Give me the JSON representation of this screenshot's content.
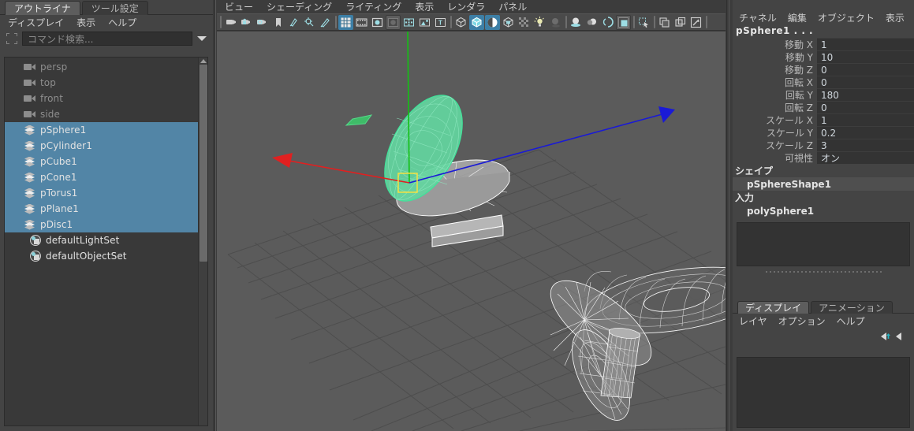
{
  "outliner_panel": {
    "tabs": [
      {
        "label": "アウトライナ",
        "active": true
      },
      {
        "label": "ツール設定",
        "active": false
      }
    ],
    "menu": [
      "ディスプレイ",
      "表示",
      "ヘルプ"
    ],
    "search": {
      "placeholder": "コマンド検索...",
      "value": ""
    },
    "items": [
      {
        "label": "persp",
        "icon": "camera-icon",
        "selected": false,
        "dim": true,
        "indent": 1
      },
      {
        "label": "top",
        "icon": "camera-icon",
        "selected": false,
        "dim": true,
        "indent": 1
      },
      {
        "label": "front",
        "icon": "camera-icon",
        "selected": false,
        "dim": true,
        "indent": 1
      },
      {
        "label": "side",
        "icon": "camera-icon",
        "selected": false,
        "dim": true,
        "indent": 1
      },
      {
        "label": "pSphere1",
        "icon": "mesh-icon",
        "selected": true,
        "dim": false,
        "indent": 1
      },
      {
        "label": "pCylinder1",
        "icon": "mesh-icon",
        "selected": true,
        "dim": false,
        "indent": 1
      },
      {
        "label": "pCube1",
        "icon": "mesh-icon",
        "selected": true,
        "dim": false,
        "indent": 1
      },
      {
        "label": "pCone1",
        "icon": "mesh-icon",
        "selected": true,
        "dim": false,
        "indent": 1
      },
      {
        "label": "pTorus1",
        "icon": "mesh-icon",
        "selected": true,
        "dim": false,
        "indent": 1
      },
      {
        "label": "pPlane1",
        "icon": "mesh-icon",
        "selected": true,
        "dim": false,
        "indent": 1
      },
      {
        "label": "pDisc1",
        "icon": "mesh-icon",
        "selected": true,
        "dim": false,
        "indent": 1
      },
      {
        "label": "defaultLightSet",
        "icon": "set-icon",
        "selected": false,
        "dim": false,
        "indent": 2
      },
      {
        "label": "defaultObjectSet",
        "icon": "set-icon",
        "selected": false,
        "dim": false,
        "indent": 2
      }
    ]
  },
  "viewport_panel": {
    "menu": [
      "ビュー",
      "シェーディング",
      "ライティング",
      "表示",
      "レンダラ",
      "パネル"
    ],
    "toolbar": [
      {
        "name": "separator",
        "type": "sep"
      },
      {
        "name": "camera-icon",
        "type": "btn",
        "state": "off"
      },
      {
        "name": "camera-lock-icon",
        "type": "btn",
        "state": "off"
      },
      {
        "name": "camera-settings-icon",
        "type": "btn",
        "state": "off"
      },
      {
        "name": "bookmark-icon",
        "type": "btn",
        "state": "off"
      },
      {
        "name": "image-plane-icon",
        "type": "btn",
        "state": "off"
      },
      {
        "name": "two-d-pan-zoom-icon",
        "type": "btn",
        "state": "off"
      },
      {
        "name": "grease-pencil-icon",
        "type": "btn",
        "state": "off"
      },
      {
        "name": "separator",
        "type": "sep"
      },
      {
        "name": "grid-icon",
        "type": "btn",
        "state": "on"
      },
      {
        "name": "film-gate-icon",
        "type": "btn",
        "state": "off"
      },
      {
        "name": "resolution-gate-icon",
        "type": "btn",
        "state": "off"
      },
      {
        "name": "gate-mask-icon",
        "type": "btn",
        "state": "on2"
      },
      {
        "name": "film-origin-icon",
        "type": "btn",
        "state": "off"
      },
      {
        "name": "field-chart-icon",
        "type": "btn",
        "state": "off"
      },
      {
        "name": "safe-title-icon",
        "type": "btn",
        "state": "off"
      },
      {
        "name": "separator",
        "type": "sep"
      },
      {
        "name": "wireframe-icon",
        "type": "btn",
        "state": "off"
      },
      {
        "name": "smooth-shade-icon",
        "type": "btn",
        "state": "on"
      },
      {
        "name": "shade-wireframe-icon",
        "type": "btn",
        "state": "on"
      },
      {
        "name": "texture-icon",
        "type": "btn",
        "state": "off"
      },
      {
        "name": "xray-icon",
        "type": "btn",
        "state": "off"
      },
      {
        "name": "lighting-icon",
        "type": "btn",
        "state": "off"
      },
      {
        "name": "shadows-icon",
        "type": "btn",
        "state": "off"
      },
      {
        "name": "separator",
        "type": "sep"
      },
      {
        "name": "ao-icon",
        "type": "btn",
        "state": "off"
      },
      {
        "name": "motion-blur-icon",
        "type": "btn",
        "state": "off"
      },
      {
        "name": "anti-alias-icon",
        "type": "btn",
        "state": "off"
      },
      {
        "name": "viewport-fx-icon",
        "type": "btn",
        "state": "on2"
      },
      {
        "name": "separator",
        "type": "sep"
      },
      {
        "name": "isolate-select-icon",
        "type": "btn",
        "state": "off"
      },
      {
        "name": "separator",
        "type": "sep"
      },
      {
        "name": "copy-view-icon",
        "type": "btn",
        "state": "off"
      },
      {
        "name": "paste-view-icon",
        "type": "btn",
        "state": "off"
      },
      {
        "name": "snapshot-icon",
        "type": "btn",
        "state": "off"
      },
      {
        "name": "separator",
        "type": "sep"
      }
    ],
    "scene": {
      "background_color": "#5b5b5b",
      "grid_color": "#4f4f4f",
      "selected_object": "pSphere1",
      "selected_highlight_color": "#5dd79a",
      "manipulator": "move-manipulator",
      "axis_colors": {
        "x": "#e02020",
        "y": "#13c113",
        "z": "#1a1ad6"
      },
      "objects": [
        "pPlane1",
        "pSphere1",
        "pDisc1",
        "pCube1",
        "pTorus1",
        "pCone1",
        "pCylinder1"
      ]
    }
  },
  "channel_box": {
    "menu": [
      "チャネル",
      "編集",
      "オブジェクト",
      "表示"
    ],
    "object_name": "pSphere1 . . .",
    "channels": [
      {
        "label": "移動 X",
        "value": "1"
      },
      {
        "label": "移動 Y",
        "value": "10"
      },
      {
        "label": "移動 Z",
        "value": "0"
      },
      {
        "label": "回転 X",
        "value": "0"
      },
      {
        "label": "回転 Y",
        "value": "180"
      },
      {
        "label": "回転 Z",
        "value": "0"
      },
      {
        "label": "スケール X",
        "value": "1"
      },
      {
        "label": "スケール Y",
        "value": "0.2"
      },
      {
        "label": "スケール Z",
        "value": "3"
      },
      {
        "label": "可視性",
        "value": "オン"
      }
    ],
    "sections": [
      {
        "header": "シェイプ",
        "items": [
          {
            "label": "pSphereShape1",
            "highlight": true
          }
        ]
      },
      {
        "header": "入力",
        "items": [
          {
            "label": "polySphere1",
            "highlight": false
          }
        ]
      }
    ]
  },
  "layer_editor": {
    "tabs": [
      {
        "label": "ディスプレイ",
        "active": true
      },
      {
        "label": "アニメーション",
        "active": false
      }
    ],
    "menu": [
      "レイヤ",
      "オプション",
      "ヘルプ"
    ],
    "buttons": [
      {
        "name": "layer-move-up-button"
      },
      {
        "name": "layer-move-down-button"
      }
    ]
  }
}
